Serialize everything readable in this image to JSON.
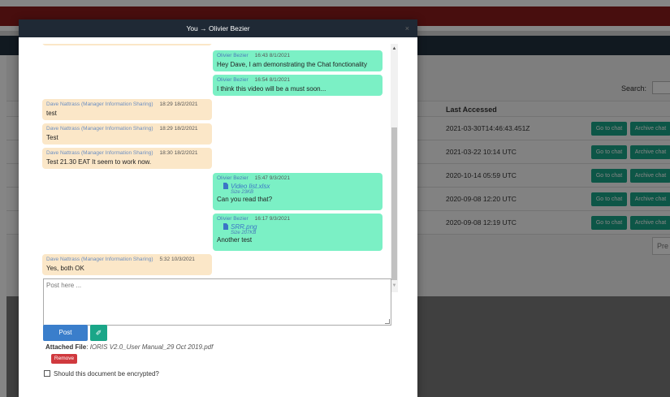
{
  "background": {
    "search_label": "Search:",
    "table_header_last_accessed": "Last Accessed",
    "rows": [
      {
        "last_accessed": "2021-03-30T14:46:43.451Z"
      },
      {
        "last_accessed": "2021-03-22 10:14 UTC"
      },
      {
        "last_accessed": "2020-10-14 05:59 UTC"
      },
      {
        "last_accessed": "2020-09-08 12:20 UTC"
      },
      {
        "last_accessed": "2020-09-08 12:19 UTC"
      }
    ],
    "go_to_chat_label": "Go to chat",
    "archive_chat_label": "Archive chat",
    "prev_label": "Pre"
  },
  "modal": {
    "title": "You → Olivier Bezier",
    "close_label": "×"
  },
  "messages": [
    {
      "sender": "Olivier Bezier",
      "time": "16:43 8/1/2021",
      "text": "Hey Dave, I am demonstrating the Chat fonctionality"
    },
    {
      "sender": "Olivier Bezier",
      "time": "16:54 8/1/2021",
      "text": "I think this video will be a must soon..."
    },
    {
      "sender": "Dave Nattrass (Manager Information Sharing)",
      "time": "18:29 18/2/2021",
      "text": "test"
    },
    {
      "sender": "Dave Nattrass (Manager Information Sharing)",
      "time": "18:29 18/2/2021",
      "text": "Test"
    },
    {
      "sender": "Dave Nattrass (Manager Information Sharing)",
      "time": "18:30 18/2/2021",
      "text": "Test 21.30 EAT It seem to work now."
    },
    {
      "sender": "Olivier Bezier",
      "time": "15:47 9/3/2021",
      "file": "Video list.xlsx",
      "size": "Size 23KB",
      "text": "Can you read that?"
    },
    {
      "sender": "Olivier Bezier",
      "time": "16:17 9/3/2021",
      "file": "SRR.png",
      "size": "Size 207KB",
      "text": "Another test"
    },
    {
      "sender": "Dave Nattrass (Manager Information Sharing)",
      "time": "5:32 10/3/2021",
      "text": "Yes, both OK"
    }
  ],
  "composer": {
    "placeholder": "Post here ...",
    "post_label": "Post",
    "attach_icon": "paperclip-icon",
    "attached_label": "Attached File",
    "attached_file": "IORIS V2.0_User Manual_29 Oct 2019.pdf",
    "remove_label": "Remove",
    "encrypt_label": "Should this document be encrypted?"
  },
  "colors": {
    "incoming_bubble": "#fbe7c8",
    "outgoing_bubble": "#7bf0c5",
    "post_button": "#3a7ecb",
    "accent_green": "#1aa688",
    "remove_button": "#d0393e",
    "modal_header": "#1f2935"
  }
}
